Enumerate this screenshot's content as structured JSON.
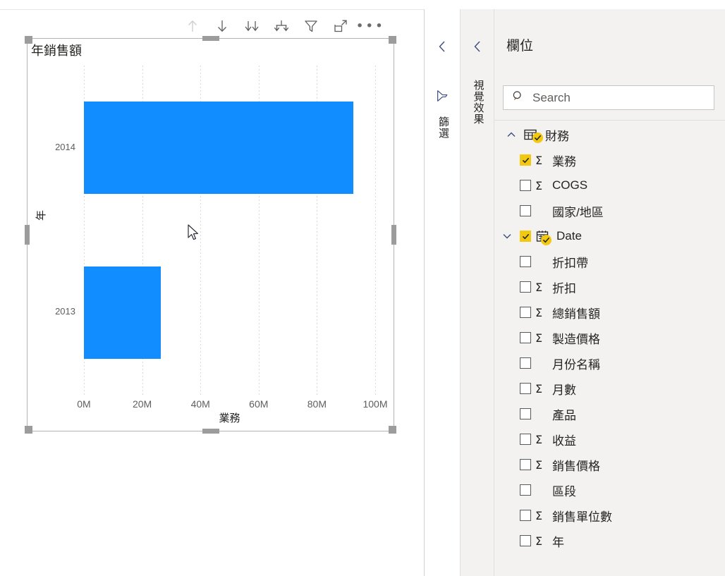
{
  "visual": {
    "title": "年銷售額",
    "toolbar": [
      {
        "name": "drill-up-icon",
        "label": "向上切入",
        "disabled": true
      },
      {
        "name": "drill-down-icon",
        "label": "向下切入",
        "disabled": false
      },
      {
        "name": "expand-next-level-icon",
        "label": "移至階層中的下一個層級",
        "disabled": false
      },
      {
        "name": "expand-all-down-icon",
        "label": "展開階層中的所有向下一個層級",
        "disabled": false
      },
      {
        "name": "filter-icon",
        "label": "篩選",
        "disabled": false
      },
      {
        "name": "focus-mode-icon",
        "label": "焦點模式",
        "disabled": false
      },
      {
        "name": "more-options-icon",
        "label": "更多選項",
        "disabled": false
      }
    ]
  },
  "chart_data": {
    "type": "bar",
    "orientation": "horizontal",
    "title": "年銷售額",
    "categories": [
      "2014",
      "2013"
    ],
    "values": [
      92.5,
      26.5
    ],
    "value_unit": "M",
    "series": [
      {
        "name": "業務",
        "values": [
          92.5,
          26.5
        ]
      }
    ],
    "xlabel": "業務",
    "ylabel": "年",
    "xlim": [
      0,
      100
    ],
    "xticks": [
      0,
      20,
      40,
      60,
      80,
      100
    ],
    "xticklabels": [
      "0M",
      "20M",
      "40M",
      "60M",
      "80M",
      "100M"
    ],
    "grid": true,
    "grid_axis": "x",
    "legend": null,
    "bar_color": "#118DFF"
  },
  "panes": {
    "filters": {
      "label": "篩選",
      "collapse_label": "展開篩選窗格"
    },
    "visualizations": {
      "label": "視覺效果",
      "collapse_label": "展開視覺效果窗格"
    }
  },
  "fields": {
    "header": "欄位",
    "search_placeholder": "Search",
    "tables": [
      {
        "name": "財務",
        "expanded": true,
        "checked": true,
        "icon": "table-icon",
        "expander": "chevron-up-icon",
        "items": [
          {
            "label": "業務",
            "checked": true,
            "measure": true,
            "icon": null
          },
          {
            "label": "COGS",
            "checked": false,
            "measure": true,
            "icon": null
          },
          {
            "label": "國家/地區",
            "checked": false,
            "measure": false,
            "icon": null
          },
          {
            "label": "Date",
            "checked": true,
            "measure": false,
            "icon": "calendar-icon",
            "expander": "chevron-down-icon",
            "badge": true
          },
          {
            "label": "折扣帶",
            "checked": false,
            "measure": false,
            "icon": null
          },
          {
            "label": "折扣",
            "checked": false,
            "measure": true,
            "icon": null
          },
          {
            "label": "總銷售額",
            "checked": false,
            "measure": true,
            "icon": null
          },
          {
            "label": "製造價格",
            "checked": false,
            "measure": true,
            "icon": null
          },
          {
            "label": "月份名稱",
            "checked": false,
            "measure": false,
            "icon": null
          },
          {
            "label": "月數",
            "checked": false,
            "measure": true,
            "icon": null
          },
          {
            "label": "產品",
            "checked": false,
            "measure": false,
            "icon": null
          },
          {
            "label": "收益",
            "checked": false,
            "measure": true,
            "icon": null
          },
          {
            "label": "銷售價格",
            "checked": false,
            "measure": true,
            "icon": null
          },
          {
            "label": "區段",
            "checked": false,
            "measure": false,
            "icon": null
          },
          {
            "label": "銷售單位數",
            "checked": false,
            "measure": true,
            "icon": null
          },
          {
            "label": "年",
            "checked": false,
            "measure": true,
            "icon": null
          }
        ]
      }
    ]
  },
  "colors": {
    "accent_blue": "#118DFF",
    "checkbox_yellow": "#F2C811",
    "pane_bg": "#f3f2f1"
  }
}
